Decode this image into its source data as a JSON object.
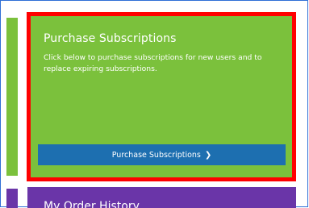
{
  "purchase_card": {
    "title": "Purchase Subscriptions",
    "description": "Click below to purchase subscriptions for new users and to replace expiring subscriptions.",
    "button_label": "Purchase Subscriptions",
    "button_icon": "chevron-right-icon",
    "color": "#7bc13c",
    "button_color": "#1d6fb0",
    "highlight_color": "#ff0000"
  },
  "orders_card": {
    "title": "My Order History",
    "color": "#6a35a8"
  }
}
